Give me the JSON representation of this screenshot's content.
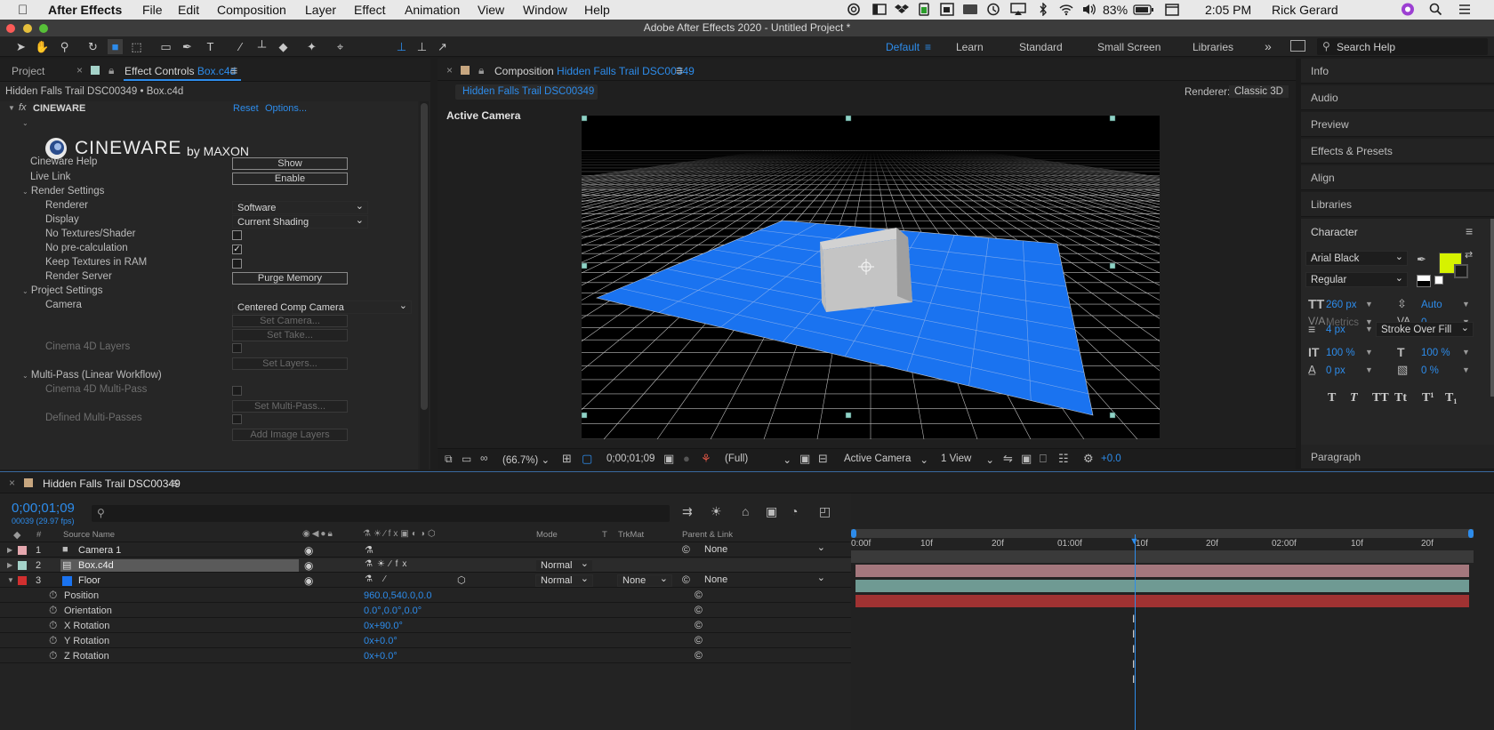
{
  "menubar": {
    "app_name": "After Effects",
    "items": [
      "File",
      "Edit",
      "Composition",
      "Layer",
      "Effect",
      "Animation",
      "View",
      "Window",
      "Help"
    ],
    "battery": "83%",
    "time": "2:05 PM",
    "user": "Rick Gerard"
  },
  "window": {
    "title": "Adobe After Effects 2020 - Untitled Project *"
  },
  "toolbar": {
    "workspaces": [
      "Default",
      "Learn",
      "Standard",
      "Small Screen",
      "Libraries"
    ],
    "active_workspace": "Default",
    "search_placeholder": "Search Help"
  },
  "effect_controls": {
    "project_tab": "Project",
    "tab_prefix": "Effect Controls",
    "tab_layer": "Box.c4d",
    "breadcrumb": "Hidden Falls Trail DSC00349 • Box.c4d",
    "effect_name": "CINEWARE",
    "reset": "Reset",
    "options": "Options...",
    "logo_text": "CINEWARE",
    "logo_by": "by MAXON",
    "cineware_help": {
      "label": "Cineware Help",
      "button": "Show"
    },
    "live_link": {
      "label": "Live Link",
      "button": "Enable"
    },
    "render_settings": "Render Settings",
    "renderer": {
      "label": "Renderer",
      "value": "Software"
    },
    "display": {
      "label": "Display",
      "value": "Current Shading"
    },
    "no_textures": {
      "label": "No Textures/Shader",
      "checked": false
    },
    "no_precalc": {
      "label": "No pre-calculation",
      "checked": true
    },
    "keep_textures": {
      "label": "Keep Textures in RAM",
      "checked": false
    },
    "render_server": {
      "label": "Render Server",
      "button": "Purge Memory"
    },
    "project_settings": "Project Settings",
    "camera": {
      "label": "Camera",
      "value": "Centered Comp Camera"
    },
    "set_camera": "Set Camera...",
    "set_take": "Set Take...",
    "c4d_layers": "Cinema 4D Layers",
    "set_layers": "Set Layers...",
    "multipass": "Multi-Pass (Linear Workflow)",
    "c4d_multipass": "Cinema 4D Multi-Pass",
    "set_multipass": "Set Multi-Pass...",
    "defined_multipasses": "Defined Multi-Passes",
    "add_image_layers": "Add Image Layers"
  },
  "composition": {
    "tab_prefix": "Composition",
    "tab_name": "Hidden Falls Trail DSC00349",
    "crumb": "Hidden Falls Trail DSC00349",
    "renderer_label": "Renderer:",
    "renderer_value": "Classic 3D",
    "view_label": "Active Camera",
    "footer": {
      "zoom": "(66.7%)",
      "timecode": "0;00;01;09",
      "resolution": "(Full)",
      "camera": "Active Camera",
      "views": "1 View",
      "exposure": "+0.0"
    }
  },
  "right_panels": {
    "items": [
      "Info",
      "Audio",
      "Preview",
      "Effects & Presets",
      "Align",
      "Libraries"
    ],
    "character": {
      "title": "Character",
      "font": "Arial Black",
      "style": "Regular",
      "size": "260 px",
      "leading": "Auto",
      "kerning": "Metrics",
      "tracking": "0",
      "stroke_width": "4 px",
      "stroke_type": "Stroke Over Fill",
      "v_scale": "100 %",
      "h_scale": "100 %",
      "baseline": "0 px",
      "tsume": "0 %",
      "fill_color": "#d6f200"
    },
    "paragraph": "Paragraph"
  },
  "timeline": {
    "tab": "Hidden Falls Trail DSC00349",
    "timecode": "0;00;01;09",
    "frames": "00039 (29.97 fps)",
    "headers": {
      "num": "#",
      "source": "Source Name",
      "mode": "Mode",
      "t": "T",
      "trkmat": "TrkMat",
      "parent": "Parent & Link"
    },
    "ruler": [
      "0:00f",
      "10f",
      "20f",
      "01:00f",
      "10f",
      "20f",
      "02:00f",
      "10f",
      "20f"
    ],
    "layers": [
      {
        "num": "1",
        "name": "Camera 1",
        "label_color": "#e5a7ae",
        "mode": "",
        "trkmat": "",
        "parent": "None",
        "bar_color": "#a4777d"
      },
      {
        "num": "2",
        "name": "Box.c4d",
        "label_color": "#a4d2c9",
        "mode": "Normal",
        "trkmat": "",
        "parent": "",
        "bar_color": "#6f9a93"
      },
      {
        "num": "3",
        "name": "Floor",
        "label_color": "#d12f2f",
        "mode": "Normal",
        "trkmat": "None",
        "parent": "None",
        "bar_color": "#a03232"
      }
    ],
    "properties": [
      {
        "name": "Position",
        "value": "960.0,540.0,0.0"
      },
      {
        "name": "Orientation",
        "value": "0.0°,0.0°,0.0°"
      },
      {
        "name": "X Rotation",
        "value": "0x+90.0°"
      },
      {
        "name": "Y Rotation",
        "value": "0x+0.0°"
      },
      {
        "name": "Z Rotation",
        "value": "0x+0.0°"
      }
    ]
  }
}
